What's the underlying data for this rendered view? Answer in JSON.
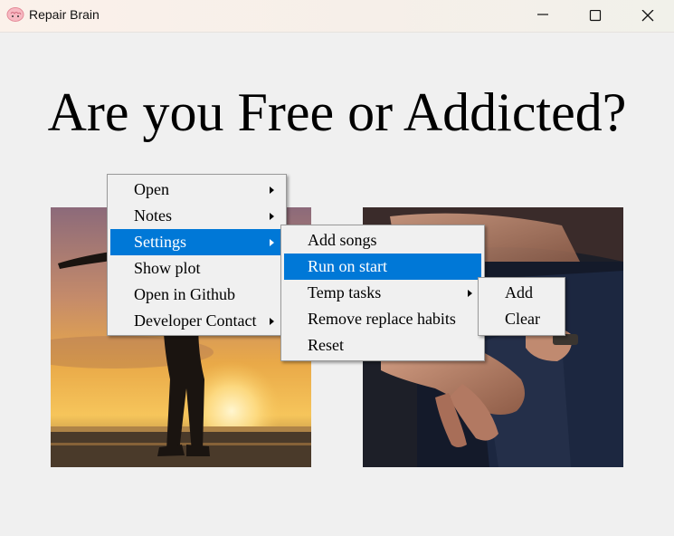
{
  "window": {
    "title": "Repair Brain",
    "app_icon": "brain-icon",
    "controls": [
      "minimize-icon",
      "maximize-icon",
      "close-icon"
    ]
  },
  "main": {
    "headline": "Are you Free or Addicted?"
  },
  "images": [
    {
      "name": "free-person-image",
      "depicts": "silhouette of person with outstretched arms at sunset beach"
    },
    {
      "name": "addicted-person-image",
      "depicts": "hands held behind back in dark jacket"
    }
  ],
  "context_menu": {
    "items": [
      {
        "label": "Open",
        "has_submenu": true
      },
      {
        "label": "Notes",
        "has_submenu": true
      },
      {
        "label": "Settings",
        "has_submenu": true,
        "active": true
      },
      {
        "label": "Show plot",
        "has_submenu": false
      },
      {
        "label": "Open in Github",
        "has_submenu": false
      },
      {
        "label": "Developer Contact",
        "has_submenu": true
      }
    ]
  },
  "settings_menu": {
    "items": [
      {
        "label": "Add songs",
        "has_submenu": false
      },
      {
        "label": "Run on start",
        "has_submenu": false,
        "active": true
      },
      {
        "label": "Temp tasks",
        "has_submenu": true
      },
      {
        "label": "Remove replace habits",
        "has_submenu": false
      },
      {
        "label": "Reset",
        "has_submenu": false
      }
    ]
  },
  "temp_tasks_menu": {
    "items": [
      {
        "label": "Add"
      },
      {
        "label": "Clear"
      }
    ]
  },
  "colors": {
    "highlight": "#0078d7",
    "background": "#f0f0f0"
  }
}
